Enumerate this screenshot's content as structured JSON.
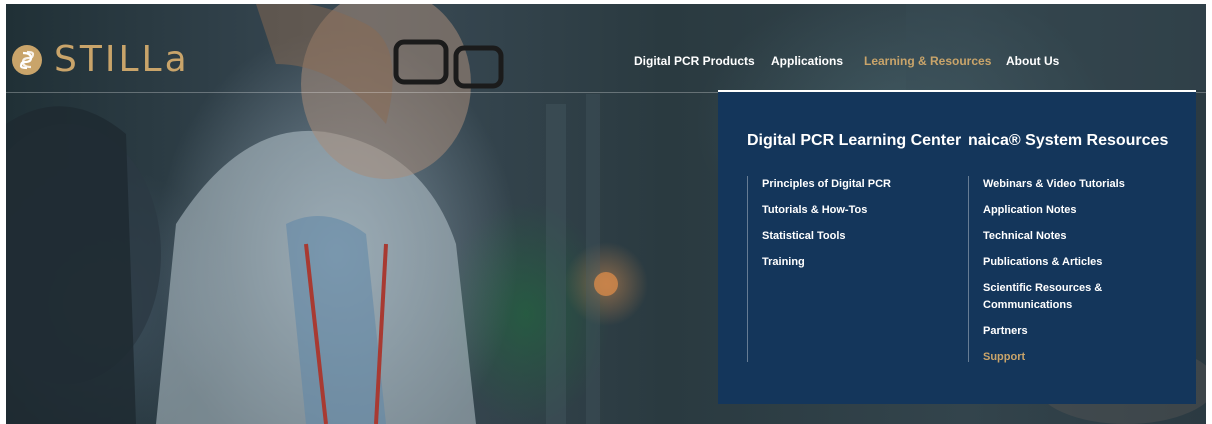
{
  "brand": {
    "name": "STILLa"
  },
  "nav": {
    "items": [
      {
        "label": "Digital PCR Products"
      },
      {
        "label": "Applications"
      },
      {
        "label": "Learning & Resources"
      },
      {
        "label": "About Us"
      }
    ],
    "active_index": 2
  },
  "mega_menu": {
    "learning_center": {
      "title": "Digital PCR Learning Center",
      "links": [
        {
          "label": "Principles of Digital PCR"
        },
        {
          "label": "Tutorials & How-Tos"
        },
        {
          "label": "Statistical Tools"
        },
        {
          "label": "Training"
        }
      ]
    },
    "system_resources": {
      "title": "naica® System Resources",
      "links": [
        {
          "label": "Webinars & Video Tutorials"
        },
        {
          "label": "Application Notes"
        },
        {
          "label": "Technical Notes"
        },
        {
          "label": "Publications & Articles"
        },
        {
          "label": "Scientific Resources & Communications"
        },
        {
          "label": "Partners"
        },
        {
          "label": "Support"
        }
      ]
    }
  },
  "colors": {
    "brand_gold": "#c9a46a",
    "menu_bg": "#14365b",
    "text_white": "#ffffff"
  },
  "icons": {
    "logo": "stilla-logo-mark"
  }
}
